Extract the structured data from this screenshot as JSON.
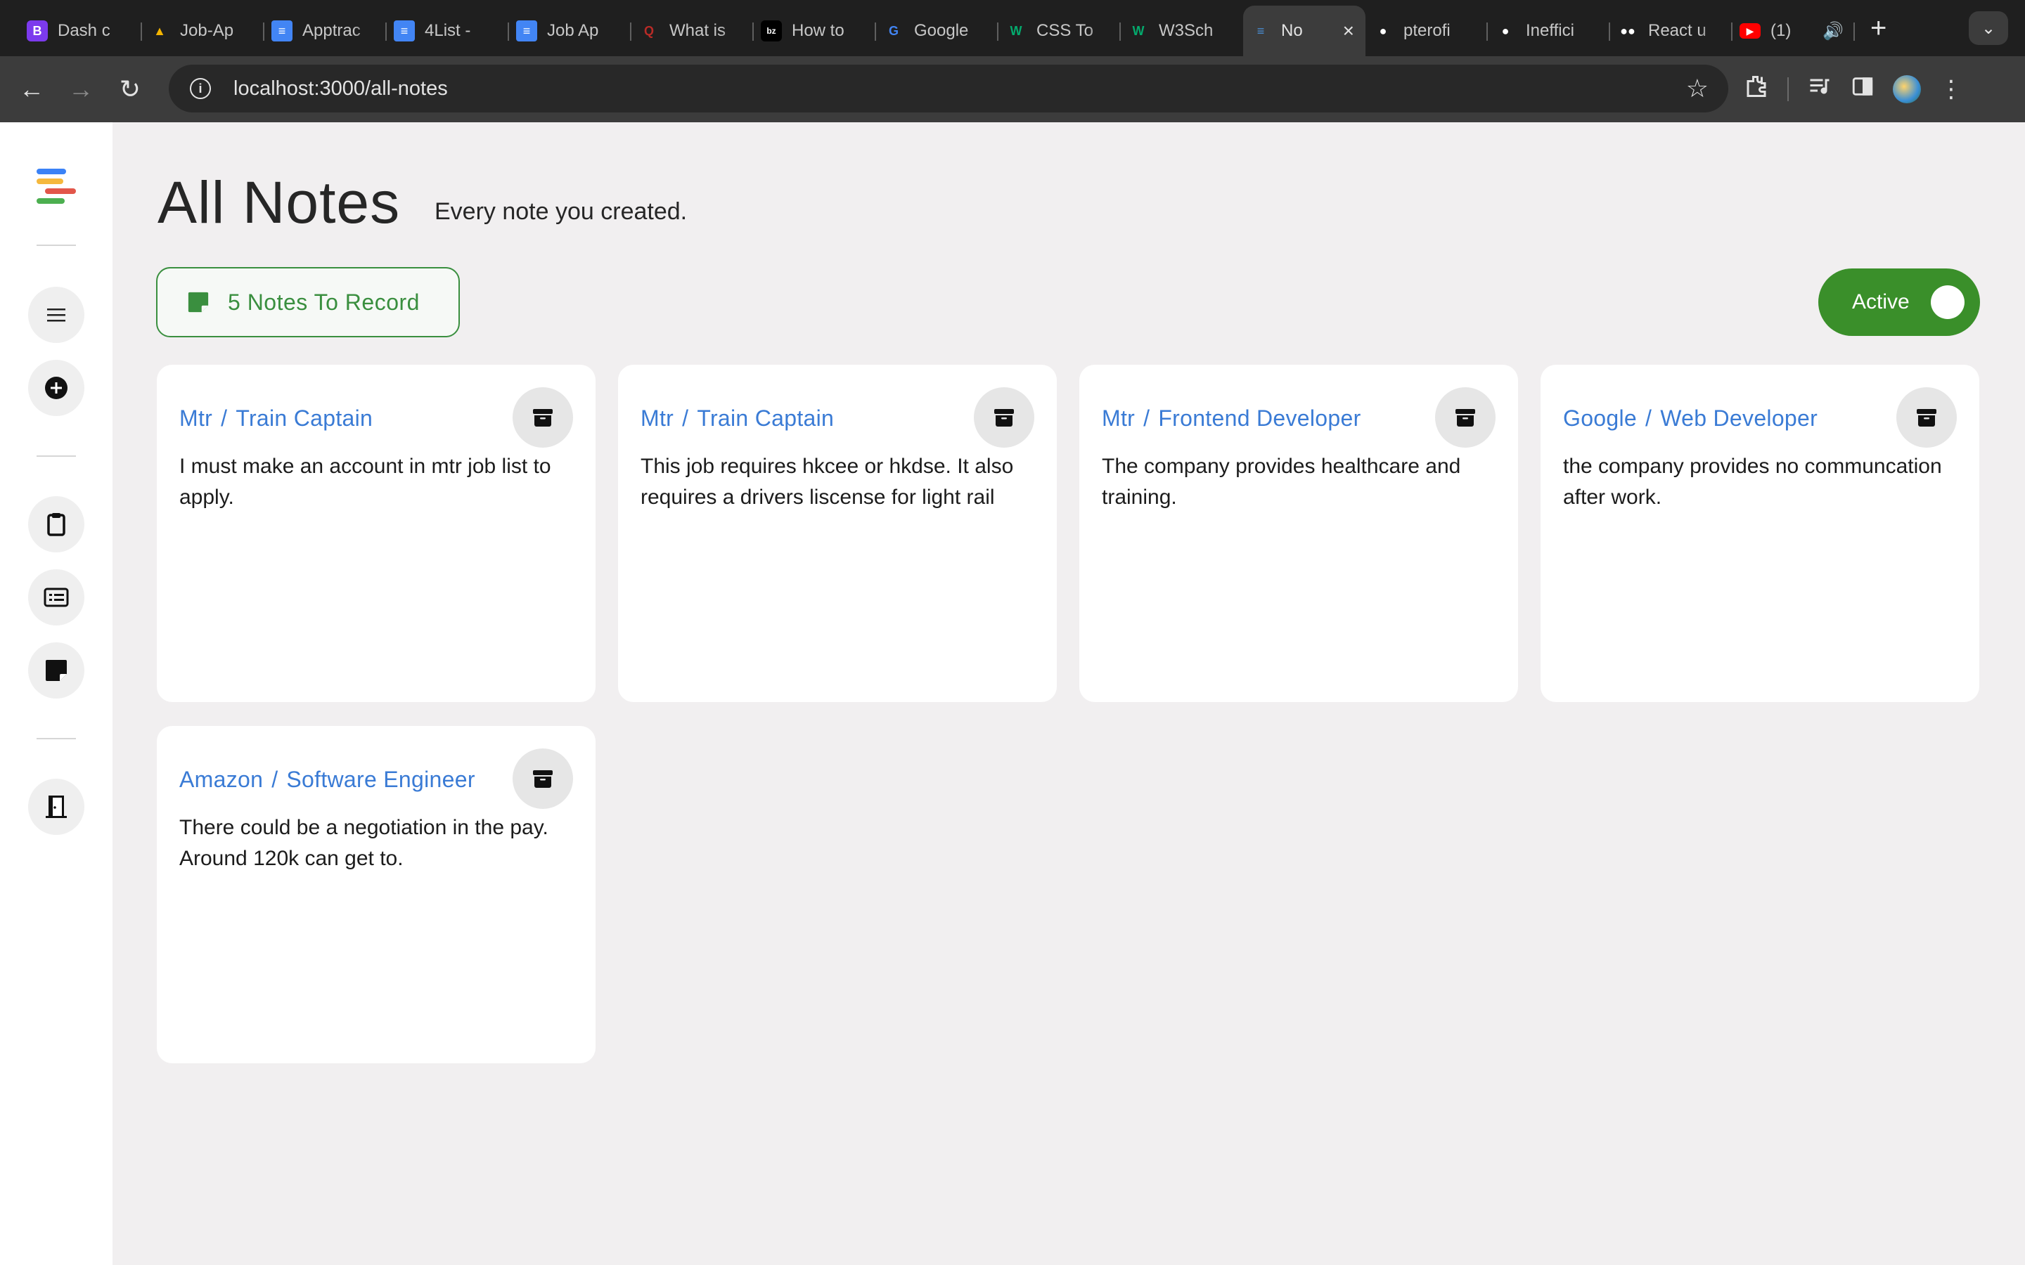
{
  "browser": {
    "tabs": [
      {
        "label": "Dash c",
        "icon": "bootstrap-icon",
        "color": "#7c3aed"
      },
      {
        "label": "Job-Ap",
        "icon": "google-drive-icon",
        "color": "#f4b400"
      },
      {
        "label": "Apptrac",
        "icon": "google-docs-icon",
        "color": "#4285f4"
      },
      {
        "label": "4List -",
        "icon": "google-docs-icon",
        "color": "#4285f4"
      },
      {
        "label": "Job Ap",
        "icon": "google-docs-icon",
        "color": "#4285f4"
      },
      {
        "label": "What is",
        "icon": "quora-icon",
        "color": "#b92b27"
      },
      {
        "label": "How to",
        "icon": "bz-icon",
        "color": "#000000"
      },
      {
        "label": "Google",
        "icon": "google-translate-icon",
        "color": "#4285f4"
      },
      {
        "label": "CSS To",
        "icon": "w3schools-icon",
        "color": "#04aa6d"
      },
      {
        "label": "W3Sch",
        "icon": "w3schools-icon",
        "color": "#04aa6d"
      },
      {
        "label": "No",
        "icon": "notes-app-icon",
        "color": "#4a90d9",
        "active": true
      },
      {
        "label": "pterofi",
        "icon": "github-icon",
        "color": "#ffffff"
      },
      {
        "label": "Ineffici",
        "icon": "github-icon",
        "color": "#ffffff"
      },
      {
        "label": "React u",
        "icon": "medium-icon",
        "color": "#ffffff"
      },
      {
        "label": "(1)",
        "icon": "youtube-icon",
        "color": "#ff0000"
      }
    ],
    "url": "localhost:3000/all-notes"
  },
  "page": {
    "title": "All Notes",
    "subtitle": "Every note you created.",
    "count_label": "5 Notes To Record",
    "toggle_label": "Active"
  },
  "notes": [
    {
      "company": "Mtr",
      "position": "Train Captain",
      "body": "I must make an account in mtr job list to apply."
    },
    {
      "company": "Mtr",
      "position": "Train Captain",
      "body": "This job requires hkcee or hkdse. It also requires a drivers liscense for light rail"
    },
    {
      "company": "Mtr",
      "position": "Frontend Developer",
      "body": "The company provides healthcare and training."
    },
    {
      "company": "Google",
      "position": "Web Developer",
      "body": "the company provides no communcation after work."
    },
    {
      "company": "Amazon",
      "position": "Software Engineer",
      "body": "There could be a negotiation in the pay. Around 120k can get to."
    }
  ],
  "colors": {
    "accent_green": "#3a8f3f",
    "toggle_green": "#3a8f2a",
    "link_blue": "#3a7bd5",
    "background": "#f1eff0"
  }
}
